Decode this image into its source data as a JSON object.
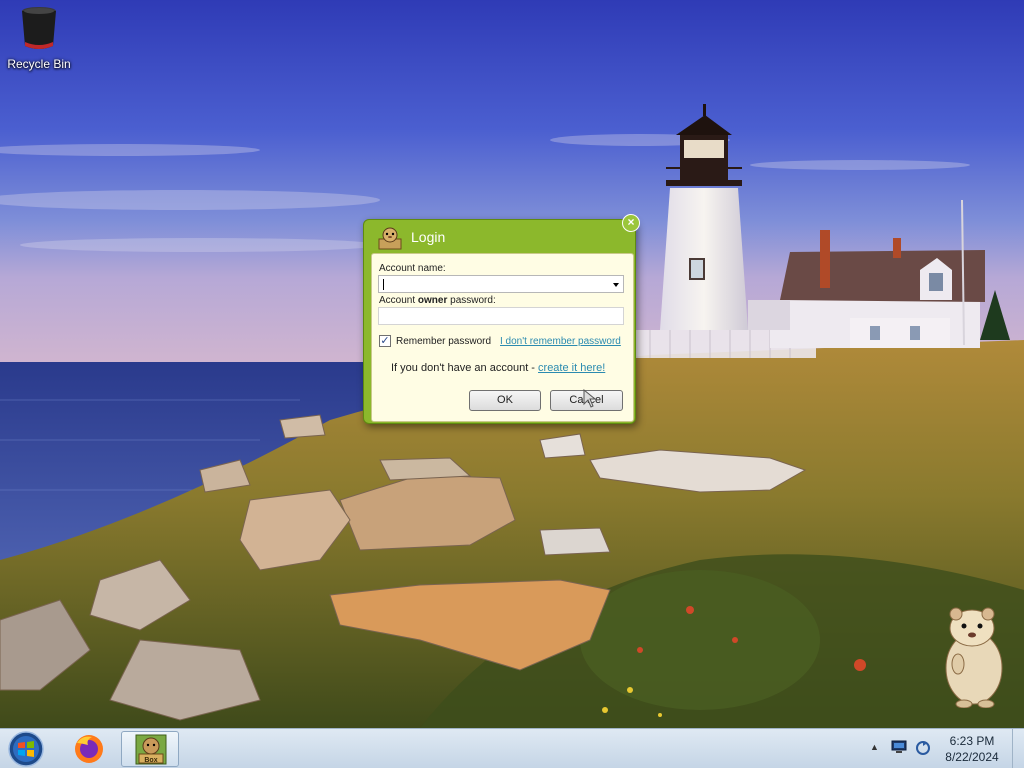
{
  "desktop": {
    "icons": [
      {
        "label": "Recycle Bin",
        "icon": "recycle-bin-icon"
      }
    ]
  },
  "login_dialog": {
    "title": "Login",
    "account_name_label": "Account name:",
    "account_name_value": "",
    "password_label_prefix": "Account ",
    "password_label_bold": "owner",
    "password_label_suffix": " password:",
    "password_value": "",
    "remember_label": "Remember password",
    "remember_checked": true,
    "forgot_link": "I don't remember password",
    "no_account_text": "If you don't have an account - ",
    "create_link": "create it here!",
    "ok_button": "OK",
    "cancel_button": "Cancel",
    "close_icon": "close-icon",
    "accent_color": "#8cb82c"
  },
  "taskbar": {
    "start_icon": "windows-start-icon",
    "pinned": [
      {
        "name": "firefox",
        "icon": "firefox-icon"
      },
      {
        "name": "box-app",
        "icon": "box-app-icon",
        "active": true
      }
    ],
    "tray_icons": [
      "show-hidden-icons-icon",
      "network-icon",
      "update-icon"
    ],
    "clock": {
      "time": "6:23 PM",
      "date": "8/22/2024"
    }
  }
}
